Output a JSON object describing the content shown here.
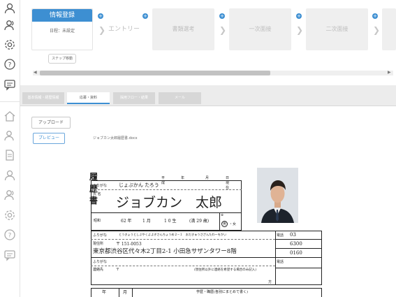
{
  "sidebar": {
    "top_icons": [
      "user-icon",
      "users-icon",
      "gear-icon",
      "help-icon",
      "chat-icon"
    ],
    "bottom_icons": [
      "home-icon",
      "users-icon",
      "document-icon",
      "user-icon",
      "users-icon",
      "gear-icon",
      "help-icon",
      "chat-icon"
    ]
  },
  "stepper": {
    "active_title": "情報登録",
    "active_status": "日程：未設定",
    "steps": [
      "エントリー",
      "書類選考",
      "一次面接",
      "二次面接"
    ],
    "step_move_label": "ステップ移動"
  },
  "tabs": [
    "基本情報・経歴情報",
    "応募・資料",
    "採用フロー・結果",
    "メール"
  ],
  "actions": {
    "upload_label": "アップロード",
    "preview_label": "プレビュー"
  },
  "file": {
    "name": "ジョブカン太郎履歴書.docx"
  },
  "resume": {
    "title": "履 歴 書",
    "date_labels": [
      "平成",
      "年",
      "月",
      "日現在"
    ],
    "furigana_label": "ふりがな",
    "furigana_value": "じょぶかん たろう",
    "name_label": "氏 名",
    "name_value": "ジョブカン　太郎",
    "birth_era": "昭和",
    "birth_year": "62 年",
    "birth_month": "1 月",
    "birth_day": "1 0 生",
    "age": "(満  29  歳)",
    "sex_label": "※",
    "sex_male": "男",
    "sex_female": "・女",
    "addr_furigana_label": "ふりがな",
    "addr_furigana_value": "とうきょうとしぶやくよよぎさんちょうめ２−１　おだきゅうさざんたわーをかい",
    "addr_label": "現住所",
    "postal": "〒 151-0053",
    "address": "東京都渋谷区代々木2丁目2-1 小田急サザンタワー8階",
    "phone_label": "電話",
    "phone_1": "03",
    "phone_2": "6300",
    "phone_3": "0160",
    "contact_furigana_label": "ふりがな",
    "contact_label": "連絡先",
    "contact_postal": "〒",
    "contact_note": "(現住所以外に連絡を希望する場合のみ記入)",
    "contact_suffix": "方",
    "contact_phone_label": "電話",
    "history_year": "年",
    "history_month": "月",
    "history_header": "学歴・職歴(各別にまとめて書く)"
  }
}
